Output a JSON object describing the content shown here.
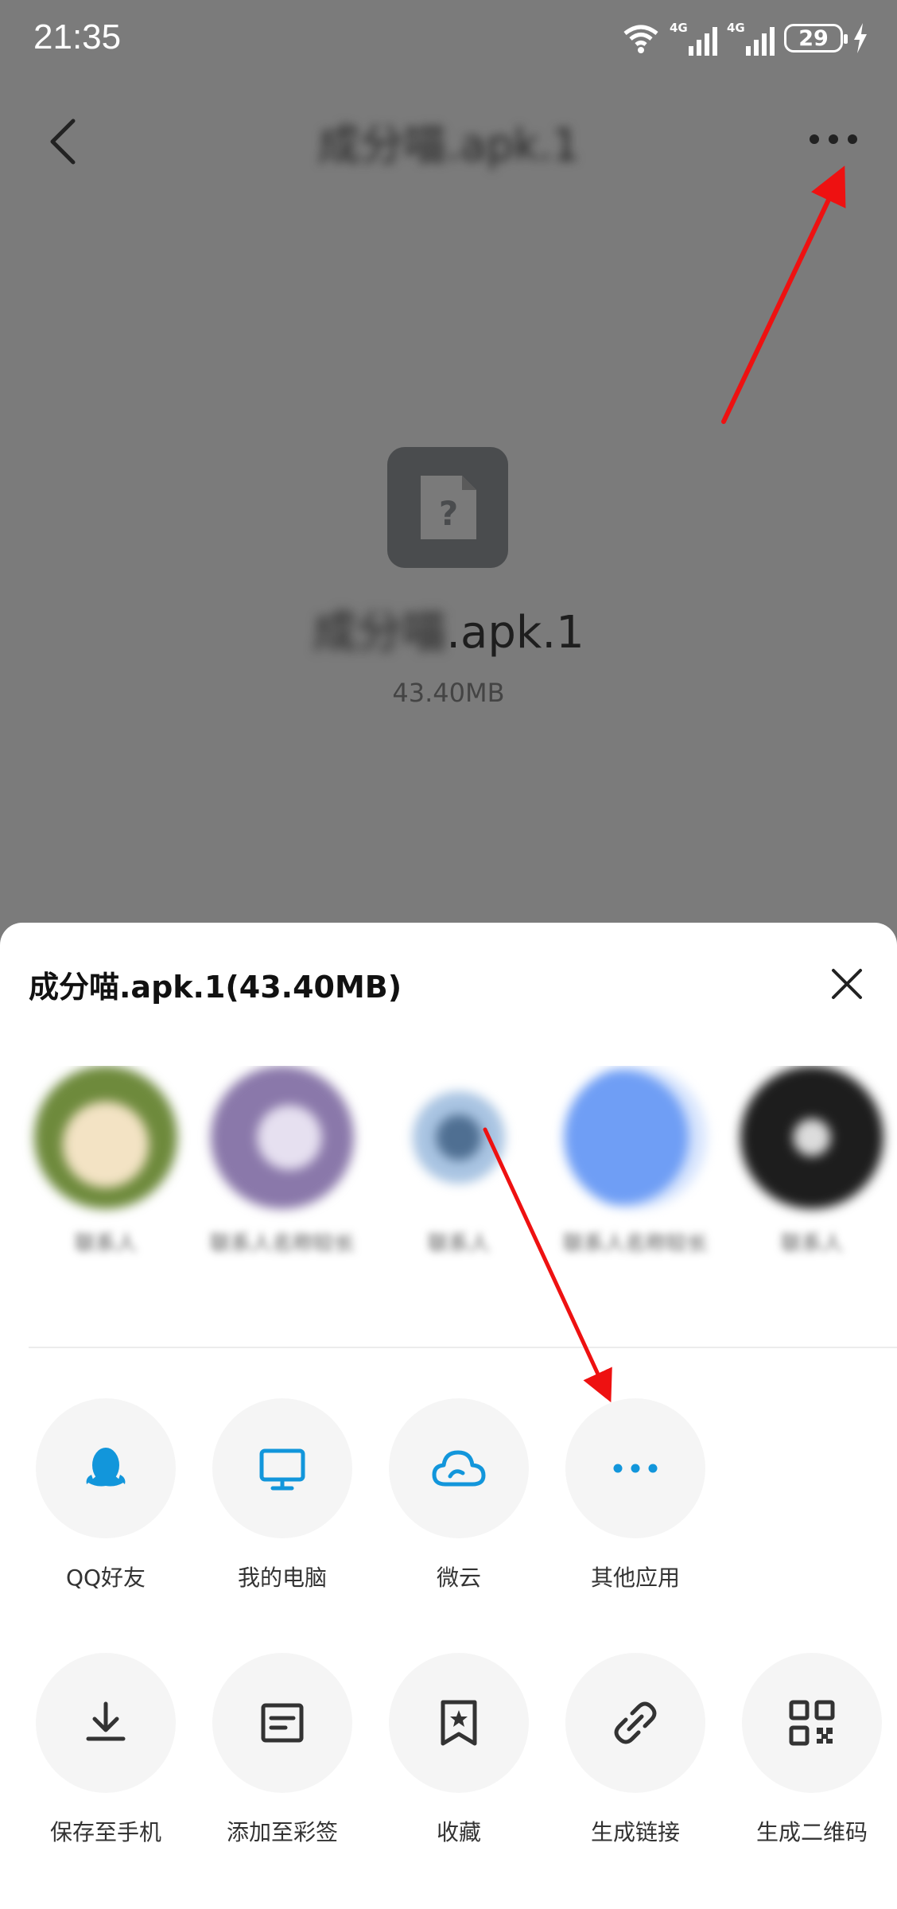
{
  "status_bar": {
    "time": "21:35",
    "network1": "4G",
    "network2": "4G",
    "battery": "29"
  },
  "header": {
    "title": "成分喵.apk.1"
  },
  "file": {
    "name_prefix": "成分喵",
    "name_suffix": ".apk.1",
    "size": "43.40MB"
  },
  "sheet": {
    "title": "成分喵.apk.1(43.40MB)",
    "contacts": [
      {
        "label": "联系人",
        "color": "#e8b97a"
      },
      {
        "label": "联系人名称较长",
        "color": "#9a88b8"
      },
      {
        "label": "联系人",
        "color": "#7fa9d9"
      },
      {
        "label": "联系人名称较长",
        "color": "#6f9ef5"
      },
      {
        "label": "联系人",
        "color": "#222222"
      }
    ],
    "share_targets": [
      {
        "label": "QQ好友",
        "icon": "qq-penguin-icon"
      },
      {
        "label": "我的电脑",
        "icon": "monitor-icon"
      },
      {
        "label": "微云",
        "icon": "cloud-icon"
      },
      {
        "label": "其他应用",
        "icon": "more-dots-icon"
      }
    ],
    "tools": [
      {
        "label": "保存至手机",
        "icon": "download-icon"
      },
      {
        "label": "添加至彩签",
        "icon": "note-icon"
      },
      {
        "label": "收藏",
        "icon": "bookmark-star-icon"
      },
      {
        "label": "生成链接",
        "icon": "link-icon"
      },
      {
        "label": "生成二维码",
        "icon": "qr-code-icon"
      }
    ]
  },
  "colors": {
    "accent": "#1296db",
    "overlay": "#7b7b7b",
    "annotation": "#ee1111"
  }
}
